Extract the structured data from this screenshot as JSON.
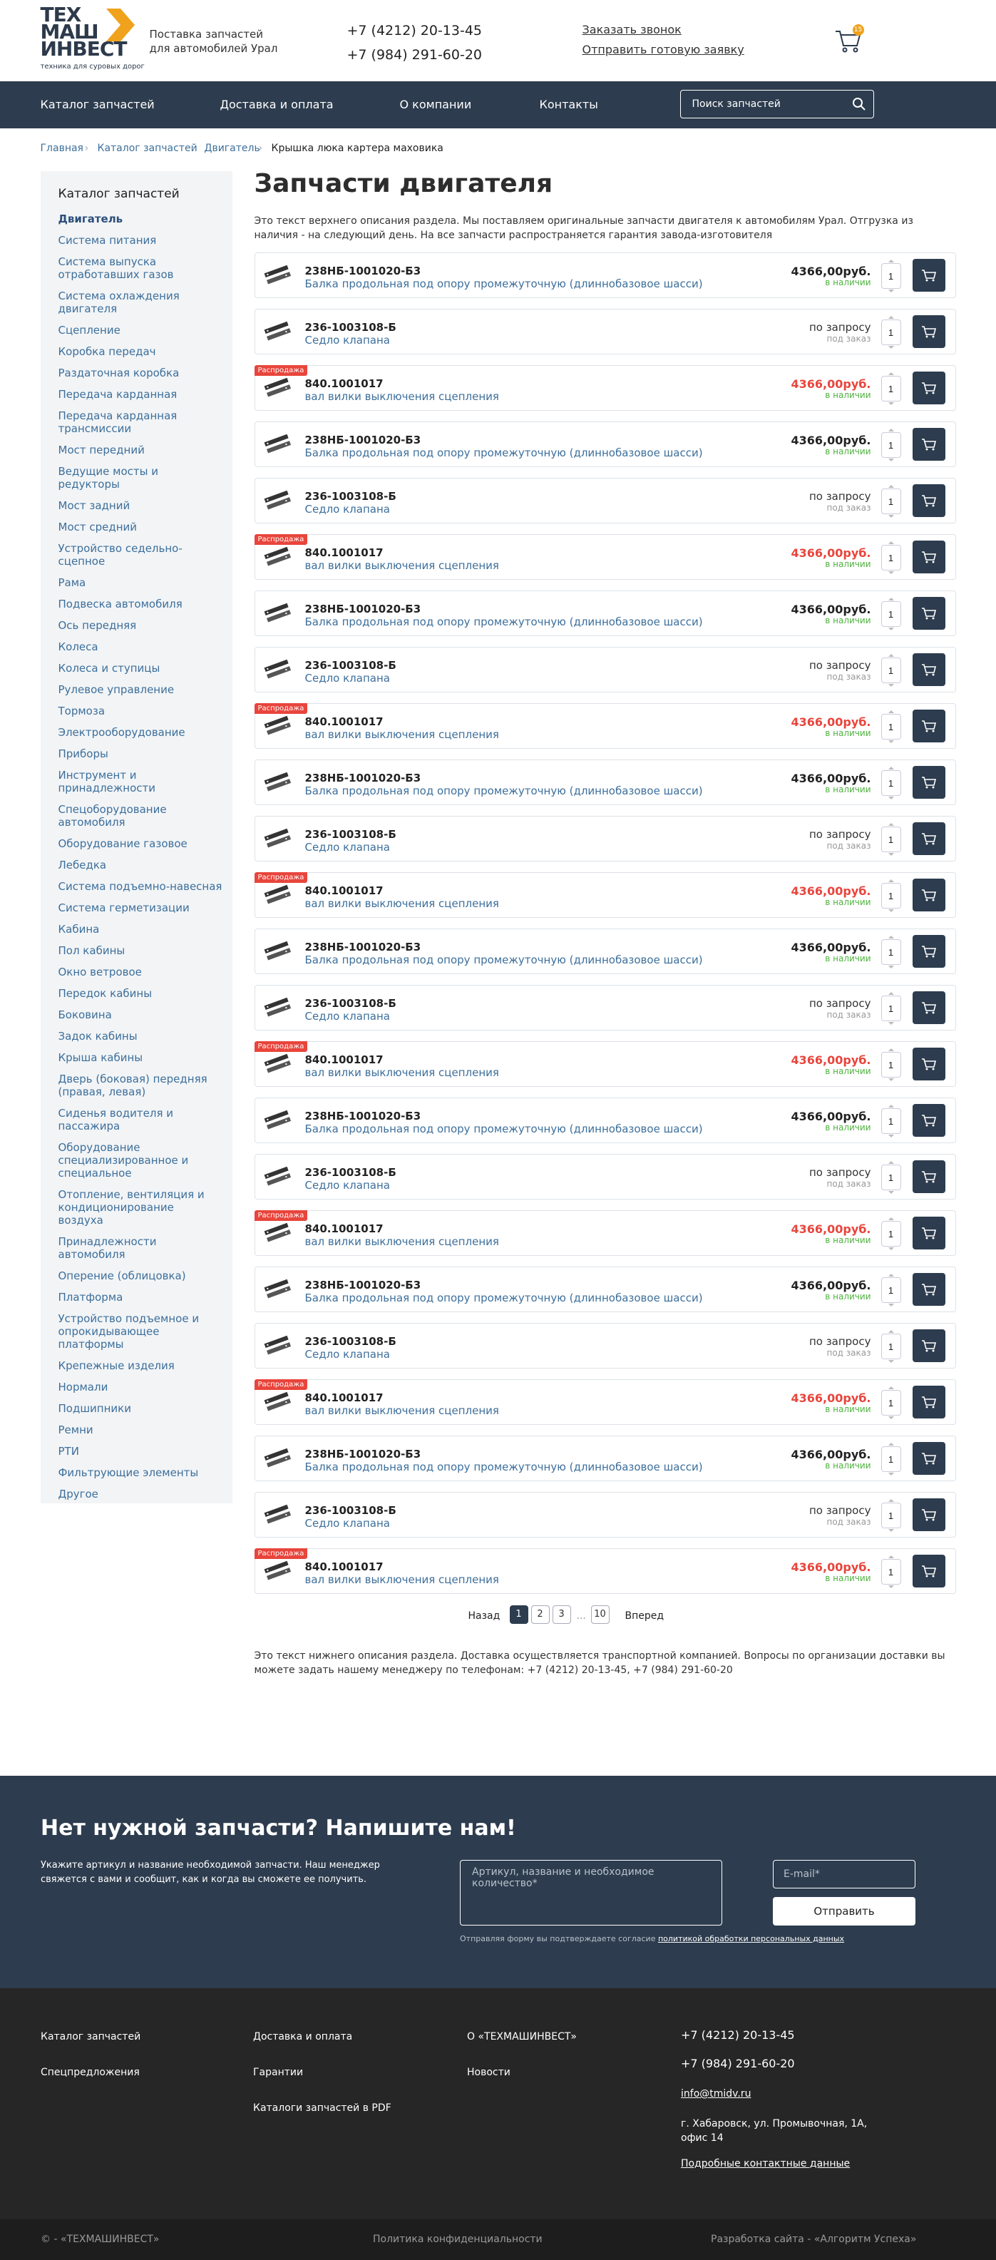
{
  "header": {
    "logo": [
      "ТЕХ",
      "МАШ",
      "ИНВЕСТ"
    ],
    "logo_tag": "техника для суровых дорог",
    "tagline": "Поставка запчастей для автомобилей Урал",
    "phones": [
      "+7 (4212) 20-13-45",
      "+7 (984) 291-60-20"
    ],
    "links": [
      "Заказать звонок",
      "Отправить готовую заявку"
    ],
    "cart_count": "15"
  },
  "nav": {
    "items": [
      "Каталог запчастей",
      "Доставка и оплата",
      "О компании",
      "Контакты"
    ],
    "search_placeholder": "Поиск запчастей"
  },
  "breadcrumbs": [
    "Главная",
    "Каталог запчастей",
    "Двигатель",
    "Крышка люка картера маховика"
  ],
  "sidebar": {
    "title": "Каталог запчастей",
    "items": [
      "Двигатель",
      "Система питания",
      "Система выпуска отработавших газов",
      "Система охлаждения двигателя",
      "Сцепление",
      "Коробка передач",
      "Раздаточная коробка",
      "Передача карданная",
      "Передача карданная трансмиссии",
      "Мост передний",
      "Ведущие мосты и редукторы",
      "Мост задний",
      "Мост средний",
      "Устройство седельно-сцепное",
      "Рама",
      "Подвеска автомобиля",
      "Ось передняя",
      "Колеса",
      "Колеса и ступицы",
      "Рулевое управление",
      "Тормоза",
      "Электрооборудование",
      "Приборы",
      "Инструмент и принадлежности",
      "Спецоборудование автомобиля",
      "Оборудование газовое",
      "Лебедка",
      "Система подъемно-навесная",
      "Система герметизации",
      "Кабина",
      "Пол кабины",
      "Окно ветровое",
      "Передок кабины",
      "Боковина",
      "Задок кабины",
      "Крыша кабины",
      "Дверь (боковая) передняя (правая, левая)",
      "Сиденья водителя и пассажира",
      "Оборудование специализированное и специальное",
      "Отопление, вентиляция и кондиционирование воздуха",
      "Принадлежности автомобиля",
      "Оперение (облицовка)",
      "Платформа",
      "Устройство подъемное и опрокидывающее платформы",
      "Крепежные изделия",
      "Нормали",
      "Подшипники",
      "Ремни",
      "РТИ",
      "Фильтрующие элементы",
      "Другое"
    ]
  },
  "main": {
    "title": "Запчасти двигателя",
    "intro": "Это текст верхнего описания раздела. Мы поставляем оригинальные запчасти двигателя к автомобилям Урал. Отгрузка из наличия - на следующий день. На все запчасти распространяется гарантия завода-изготовителя",
    "sale_label": "Распродажа",
    "qty": "1",
    "items": [
      {
        "art": "238НБ-1001020-Б3",
        "name": "Балка продольная под опору промежуточную (длиннобазовое шасси)",
        "price": "4366,00руб.",
        "status": "в наличии",
        "kind": "normal"
      },
      {
        "art": "236-1003108-Б",
        "name": "Седло клапана",
        "price": "по запросу",
        "status": "под заказ",
        "kind": "request"
      },
      {
        "art": "840.1001017",
        "name": "вал вилки выключения сцепления",
        "price": "4366,00руб.",
        "status": "в наличии",
        "kind": "sale"
      },
      {
        "art": "238НБ-1001020-Б3",
        "name": "Балка продольная под опору промежуточную (длиннобазовое шасси)",
        "price": "4366,00руб.",
        "status": "в наличии",
        "kind": "normal"
      },
      {
        "art": "236-1003108-Б",
        "name": "Седло клапана",
        "price": "по запросу",
        "status": "под заказ",
        "kind": "request"
      },
      {
        "art": "840.1001017",
        "name": "вал вилки выключения сцепления",
        "price": "4366,00руб.",
        "status": "в наличии",
        "kind": "sale"
      },
      {
        "art": "238НБ-1001020-Б3",
        "name": "Балка продольная под опору промежуточную (длиннобазовое шасси)",
        "price": "4366,00руб.",
        "status": "в наличии",
        "kind": "normal"
      },
      {
        "art": "236-1003108-Б",
        "name": "Седло клапана",
        "price": "по запросу",
        "status": "под заказ",
        "kind": "request"
      },
      {
        "art": "840.1001017",
        "name": "вал вилки выключения сцепления",
        "price": "4366,00руб.",
        "status": "в наличии",
        "kind": "sale"
      },
      {
        "art": "238НБ-1001020-Б3",
        "name": "Балка продольная под опору промежуточную (длиннобазовое шасси)",
        "price": "4366,00руб.",
        "status": "в наличии",
        "kind": "normal"
      },
      {
        "art": "236-1003108-Б",
        "name": "Седло клапана",
        "price": "по запросу",
        "status": "под заказ",
        "kind": "request"
      },
      {
        "art": "840.1001017",
        "name": "вал вилки выключения сцепления",
        "price": "4366,00руб.",
        "status": "в наличии",
        "kind": "sale"
      },
      {
        "art": "238НБ-1001020-Б3",
        "name": "Балка продольная под опору промежуточную (длиннобазовое шасси)",
        "price": "4366,00руб.",
        "status": "в наличии",
        "kind": "normal"
      },
      {
        "art": "236-1003108-Б",
        "name": "Седло клапана",
        "price": "по запросу",
        "status": "под заказ",
        "kind": "request"
      },
      {
        "art": "840.1001017",
        "name": "вал вилки выключения сцепления",
        "price": "4366,00руб.",
        "status": "в наличии",
        "kind": "sale"
      },
      {
        "art": "238НБ-1001020-Б3",
        "name": "Балка продольная под опору промежуточную (длиннобазовое шасси)",
        "price": "4366,00руб.",
        "status": "в наличии",
        "kind": "normal"
      },
      {
        "art": "236-1003108-Б",
        "name": "Седло клапана",
        "price": "по запросу",
        "status": "под заказ",
        "kind": "request"
      },
      {
        "art": "840.1001017",
        "name": "вал вилки выключения сцепления",
        "price": "4366,00руб.",
        "status": "в наличии",
        "kind": "sale"
      },
      {
        "art": "238НБ-1001020-Б3",
        "name": "Балка продольная под опору промежуточную (длиннобазовое шасси)",
        "price": "4366,00руб.",
        "status": "в наличии",
        "kind": "normal"
      },
      {
        "art": "236-1003108-Б",
        "name": "Седло клапана",
        "price": "по запросу",
        "status": "под заказ",
        "kind": "request"
      },
      {
        "art": "840.1001017",
        "name": "вал вилки выключения сцепления",
        "price": "4366,00руб.",
        "status": "в наличии",
        "kind": "sale"
      },
      {
        "art": "238НБ-1001020-Б3",
        "name": "Балка продольная под опору промежуточную (длиннобазовое шасси)",
        "price": "4366,00руб.",
        "status": "в наличии",
        "kind": "normal"
      },
      {
        "art": "236-1003108-Б",
        "name": "Седло клапана",
        "price": "по запросу",
        "status": "под заказ",
        "kind": "request"
      },
      {
        "art": "840.1001017",
        "name": "вал вилки выключения сцепления",
        "price": "4366,00руб.",
        "status": "в наличии",
        "kind": "sale"
      }
    ],
    "pagination": {
      "prev": "Назад",
      "pages": [
        "1",
        "2",
        "3"
      ],
      "ellipsis": "...",
      "last": "10",
      "next": "Вперед"
    },
    "outro": "Это текст нижнего описания раздела. Доставка осуществляется транспортной компанией. Вопросы по организации доставки вы можете задать нашему менеджеру по телефонам: +7 (4212) 20-13-45, +7 (984) 291-60-20"
  },
  "form": {
    "title": "Нет нужной запчасти? Напишите нам!",
    "text": "Укажите артикул и название необходимой запчасти. Наш менеджер свяжется с вами и сообщит, как и когда вы сможете ее получить.",
    "textarea_placeholder": "Артикул, название и необходимое количество*",
    "email_placeholder": "E-mail*",
    "submit": "Отправить",
    "agree_text": "Отправляя форму вы подтверждаете согласие ",
    "agree_link": "политикой обработки персональных данных"
  },
  "footer": {
    "col1": [
      "Каталог запчастей",
      "Спецпредложения"
    ],
    "col2": [
      "Доставка и оплата",
      "Гарантии",
      "Каталоги запчастей в PDF"
    ],
    "col3": [
      "О «ТЕХМАШИНВЕСТ»",
      "Новости"
    ],
    "phones": [
      "+7 (4212) 20-13-45",
      "+7 (984) 291-60-20"
    ],
    "email": "info@tmidv.ru",
    "address": "г. Хабаровск, ул. Промывочная, 1А, офис 14",
    "contacts_link": "Подробные контактные данные"
  },
  "bottom": {
    "copy": "© - «ТЕХМАШИНВЕСТ»",
    "policy": "Политика конфиденциальности",
    "dev": "Разработка сайта - «Алгоритм Успеха»"
  },
  "colors": {
    "navy": "#2d3c4e",
    "link": "#3d6f9b",
    "sale": "#e8453c",
    "stock": "#4fb33f",
    "accent": "#f0a21c"
  }
}
